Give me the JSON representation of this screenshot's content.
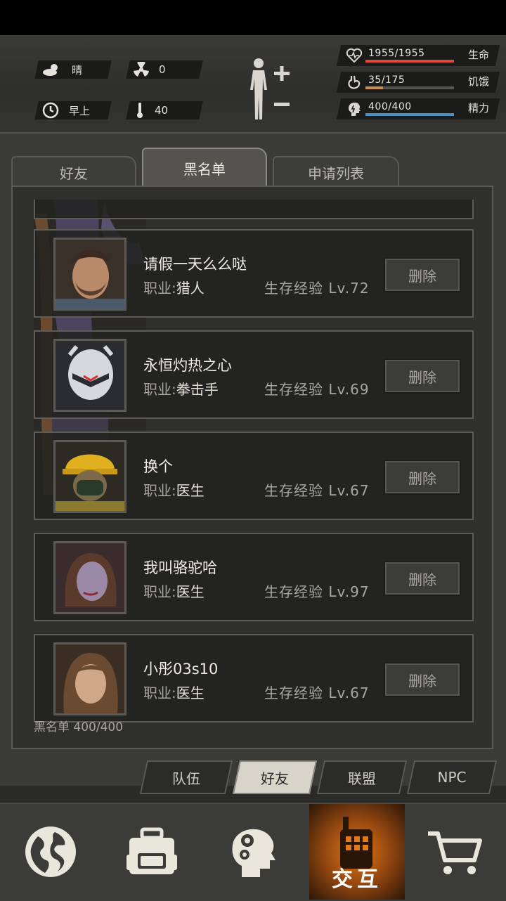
{
  "hud": {
    "weather": "晴",
    "radiation": "0",
    "time_of_day": "早上",
    "temperature": "40",
    "stats": [
      {
        "value": "1955/1955",
        "label": "生命",
        "fraction": 1.0,
        "color": "#e0493a",
        "icon": "heart-icon"
      },
      {
        "value": "35/175",
        "label": "饥饿",
        "fraction": 0.2,
        "color": "#c89050",
        "icon": "stomach-icon"
      },
      {
        "value": "400/400",
        "label": "精力",
        "fraction": 1.0,
        "color": "#4a8fc4",
        "icon": "brain-icon"
      }
    ]
  },
  "tabs": [
    {
      "label": "好友",
      "active": false
    },
    {
      "label": "黑名单",
      "active": true
    },
    {
      "label": "申请列表",
      "active": false
    }
  ],
  "job_prefix": "职业",
  "exp_prefix": "生存经验",
  "delete_label": "删除",
  "blacklist": [
    {
      "name": "请假一天么么哒",
      "job": "猎人",
      "level": "Lv.72",
      "avatar": "bearded-man-avatar"
    },
    {
      "name": "永恒灼热之心",
      "job": "拳击手",
      "level": "Lv.69",
      "avatar": "masked-helmet-avatar"
    },
    {
      "name": "换个",
      "job": "医生",
      "level": "Lv.67",
      "avatar": "hardhat-gasmask-avatar"
    },
    {
      "name": "我叫骆驼哈",
      "job": "医生",
      "level": "Lv.97",
      "avatar": "dark-haired-woman-avatar"
    },
    {
      "name": "小彤03s10",
      "job": "医生",
      "level": "Lv.67",
      "avatar": "brown-haired-woman-avatar"
    }
  ],
  "count_label": "黑名单",
  "count_value": "400/400",
  "subtabs": [
    {
      "label": "队伍",
      "active": false
    },
    {
      "label": "好友",
      "active": true
    },
    {
      "label": "联盟",
      "active": false
    },
    {
      "label": "NPC",
      "active": false
    }
  ],
  "nav": {
    "interact_label": "交互"
  }
}
